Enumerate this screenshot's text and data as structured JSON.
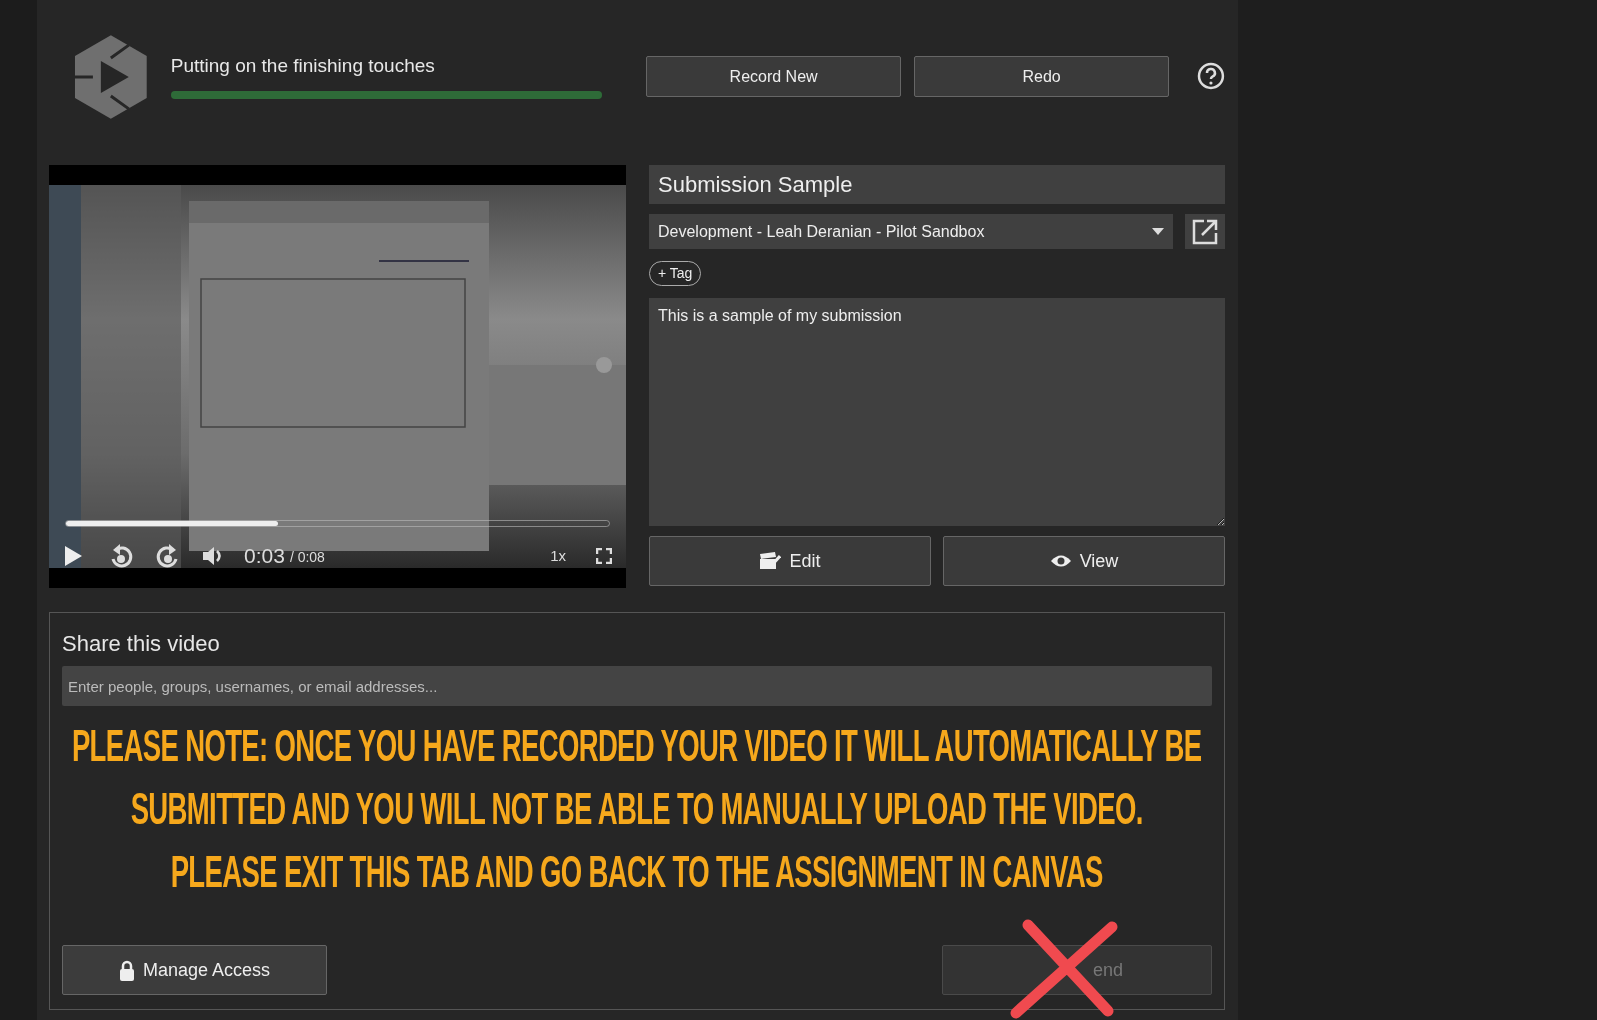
{
  "status": {
    "text": "Putting on the finishing touches",
    "level": 1
  },
  "header_buttons": [
    "Record New",
    "Redo"
  ],
  "player": {
    "level": 0.39,
    "time": "0:03",
    "duration": "/ 0:08",
    "speed": "1x"
  },
  "title_field": {
    "value": "Submission Sample"
  },
  "folder_select": {
    "value": "Development - Leah Deranian - Pilot Sandbox"
  },
  "tag_button": "+ Tag",
  "description": {
    "value": "This is a sample of my submission"
  },
  "action_buttons": [
    {
      "label": "Edit",
      "kind": "edit"
    },
    {
      "label": "View",
      "kind": "view"
    }
  ],
  "share": {
    "title": "Share this video",
    "placeholder": "Enter people, groups, usernames, or email addresses...",
    "manage_button": "Manage Access",
    "send_button": {
      "label": "end",
      "disabled": true
    }
  },
  "notice": [
    "PLEASE NOTE: ONCE YOU HAVE RECORDED YOUR VIDEO IT WILL AUTOMATICALLY BE",
    "SUBMITTED AND YOU WILL NOT BE ABLE TO MANUALLY UPLOAD THE VIDEO.",
    "PLEASE EXIT THIS TAB AND GO BACK TO THE ASSIGNMENT IN CANVAS"
  ]
}
